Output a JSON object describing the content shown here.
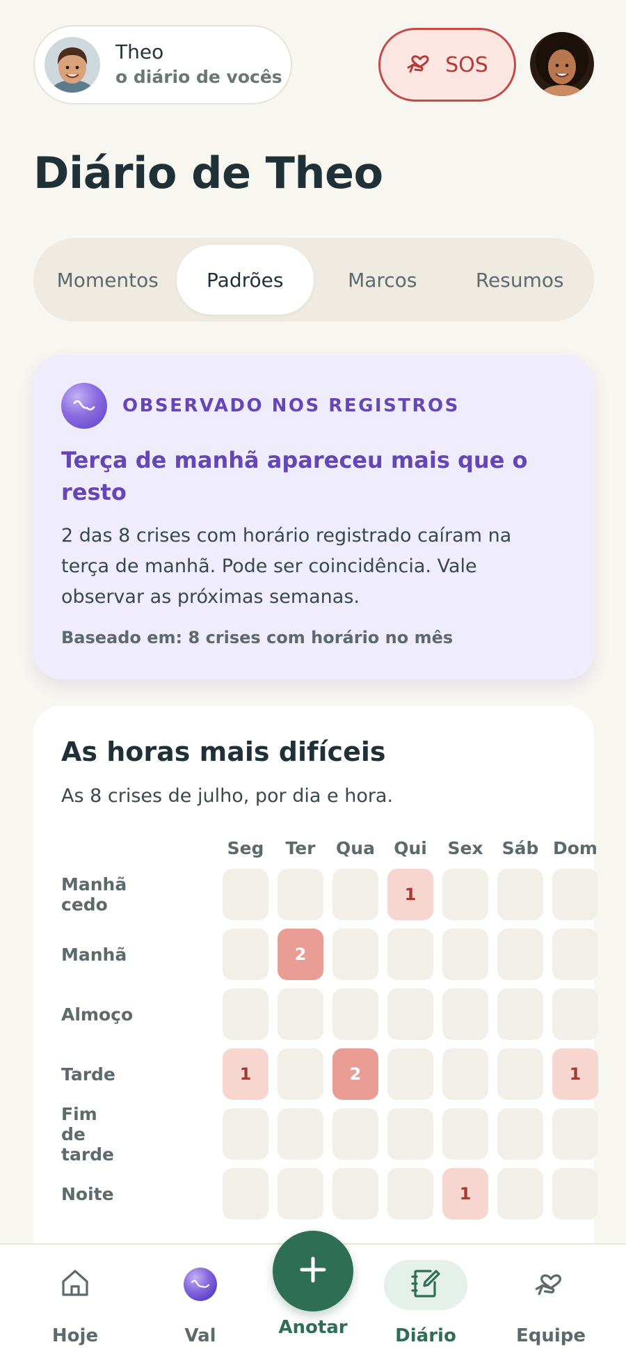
{
  "header": {
    "child_name": "Theo",
    "child_subtitle": "o diário de vocês",
    "sos_label": "SOS"
  },
  "page_title": "Diário de Theo",
  "tabs": [
    {
      "label": "Momentos",
      "active": false
    },
    {
      "label": "Padrões",
      "active": true
    },
    {
      "label": "Marcos",
      "active": false
    },
    {
      "label": "Resumos",
      "active": false
    }
  ],
  "insight": {
    "label": "OBSERVADO NOS REGISTROS",
    "title": "Terça de manhã apareceu mais que o resto",
    "body": "2 das 8 crises com horário registrado caíram na terça de manhã. Pode ser coincidência. Vale observar as próximas semanas.",
    "basis": "Baseado em: 8 crises com horário no mês"
  },
  "hours_card": {
    "title": "As horas mais difíceis",
    "subtitle": "As 8 crises de julho, por dia e hora.",
    "days": [
      "Seg",
      "Ter",
      "Qua",
      "Qui",
      "Sex",
      "Sáb",
      "Dom"
    ],
    "rows": [
      {
        "label": "Manhã cedo",
        "counts": [
          0,
          0,
          0,
          1,
          0,
          0,
          0
        ]
      },
      {
        "label": "Manhã",
        "counts": [
          0,
          2,
          0,
          0,
          0,
          0,
          0
        ]
      },
      {
        "label": "Almoço",
        "counts": [
          0,
          0,
          0,
          0,
          0,
          0,
          0
        ]
      },
      {
        "label": "Tarde",
        "counts": [
          1,
          0,
          2,
          0,
          0,
          0,
          1
        ]
      },
      {
        "label": "Fim de tarde",
        "counts": [
          0,
          0,
          0,
          0,
          0,
          0,
          0
        ]
      },
      {
        "label": "Noite",
        "counts": [
          0,
          0,
          0,
          0,
          1,
          0,
          0
        ]
      }
    ]
  },
  "nav": {
    "hoje": "Hoje",
    "val": "Val",
    "anotar": "Anotar",
    "diario": "Diário",
    "equipe": "Equipe"
  },
  "colors": {
    "accent_green": "#2e6e55",
    "insight_purple": "#6446b8",
    "sos_red": "#c44a45",
    "heat_low": "#f7d6d0",
    "heat_high": "#e99d95"
  }
}
